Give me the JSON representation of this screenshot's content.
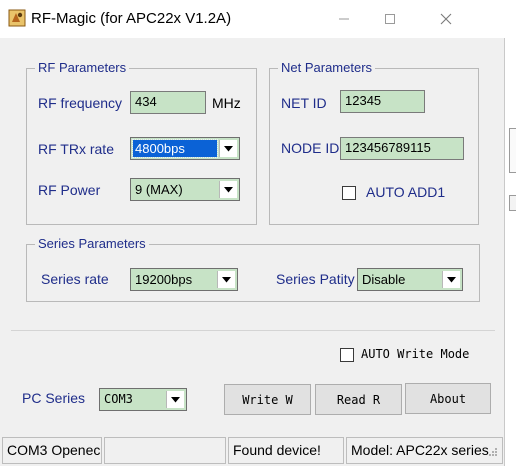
{
  "window": {
    "title": "RF-Magic (for APC22x V1.2A)"
  },
  "rf_parameters": {
    "title": "RF Parameters",
    "frequency": {
      "label": "RF frequency",
      "value": "434",
      "unit": "MHz"
    },
    "trx_rate": {
      "label": "RF TRx rate",
      "value": "4800bps"
    },
    "power": {
      "label": "RF Power",
      "value": "9 (MAX)"
    }
  },
  "net_parameters": {
    "title": "Net Parameters",
    "net_id": {
      "label": "NET ID",
      "value": "12345"
    },
    "node_id": {
      "label": "NODE ID",
      "value": "123456789115"
    },
    "auto_add": {
      "label": "AUTO ADD1",
      "checked": false
    }
  },
  "series_parameters": {
    "title": "Series Parameters",
    "rate": {
      "label": "Series rate",
      "value": "19200bps"
    },
    "parity": {
      "label": "Series Patity",
      "value": "Disable"
    }
  },
  "auto_write": {
    "label": "AUTO Write Mode",
    "checked": false
  },
  "pc_series": {
    "label": "PC Series",
    "value": "COM3"
  },
  "buttons": {
    "write": "Write W",
    "read": "Read R",
    "about": "About"
  },
  "status_bar": [
    "COM3 Openec",
    "",
    "Found device!",
    "Model: APC22x series"
  ],
  "colors": {
    "field_bg": "#c7e3c6",
    "label_text": "#1f2d8a",
    "selection": "#0b62d6"
  }
}
